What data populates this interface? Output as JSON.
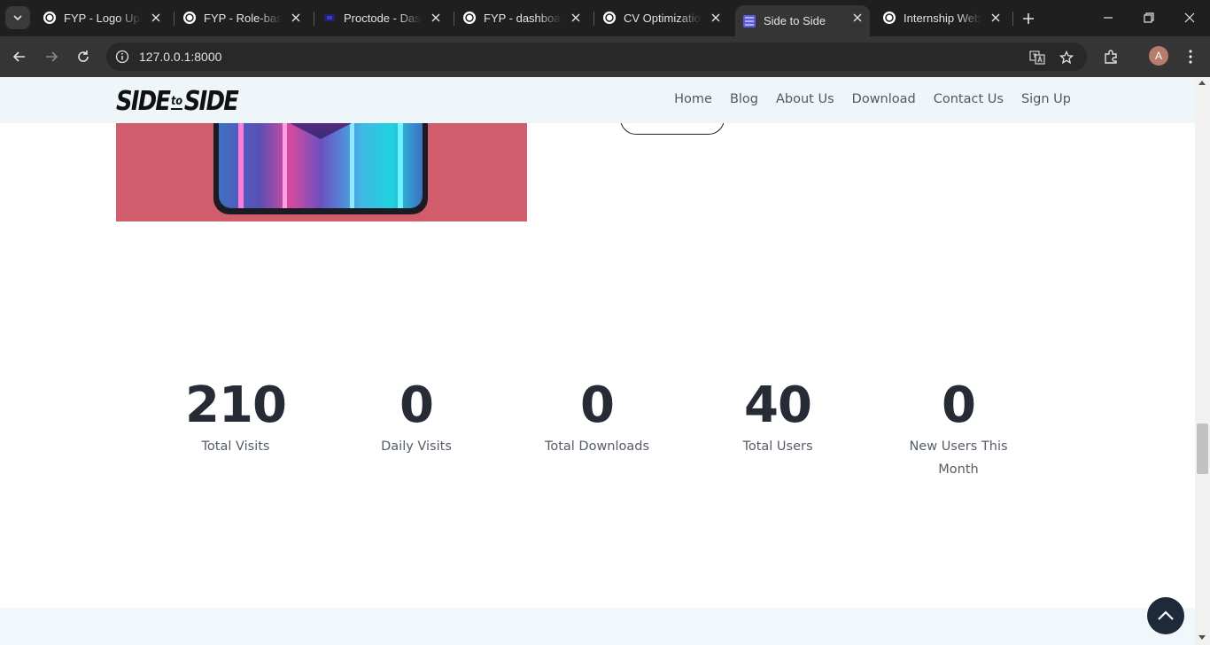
{
  "browser": {
    "tabs": [
      {
        "title": "FYP - Logo Uplo",
        "active": false
      },
      {
        "title": "FYP - Role-base",
        "active": false
      },
      {
        "title": "Proctode - Dash",
        "active": false
      },
      {
        "title": "FYP - dashboard",
        "active": false
      },
      {
        "title": "CV Optimization",
        "active": false
      },
      {
        "title": "Side to Side",
        "active": true
      },
      {
        "title": "Internship Web I",
        "active": false
      }
    ],
    "url": "127.0.0.1:8000",
    "profile_initial": "A"
  },
  "site": {
    "logo": {
      "left": "SIDE",
      "middle": "to",
      "right": "SIDE"
    },
    "nav": [
      "Home",
      "Blog",
      "About Us",
      "Download",
      "Contact Us",
      "Sign Up"
    ]
  },
  "stats": [
    {
      "value": "210",
      "label": "Total Visits"
    },
    {
      "value": "0",
      "label": "Daily Visits"
    },
    {
      "value": "0",
      "label": "Total Downloads"
    },
    {
      "value": "40",
      "label": "Total Users"
    },
    {
      "value": "0",
      "label": "New Users This Month"
    }
  ],
  "colors": {
    "nav_bg": "#eff6fa",
    "stat_number": "#262b36",
    "back_to_top": "#1e2939",
    "hero_bg": "#d15c6c"
  },
  "icons": {
    "back_to_top": "chevron-up-icon"
  }
}
